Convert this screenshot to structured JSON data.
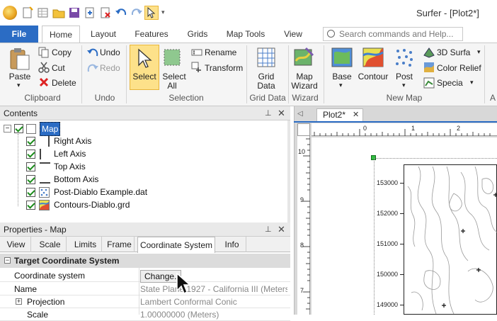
{
  "window": {
    "title": "Surfer - [Plot2*]"
  },
  "ribbon_tabs": [
    "File",
    "Home",
    "Layout",
    "Features",
    "Grids",
    "Map Tools",
    "View"
  ],
  "search": {
    "placeholder": "Search commands and Help..."
  },
  "clipboard": {
    "paste": "Paste",
    "copy": "Copy",
    "cut": "Cut",
    "delete": "Delete",
    "group": "Clipboard"
  },
  "undo": {
    "undo": "Undo",
    "redo": "Redo",
    "group": "Undo"
  },
  "selection": {
    "select": "Select",
    "select_all_1": "Select",
    "select_all_2": "All",
    "rename": "Rename",
    "transform": "Transform",
    "group": "Selection"
  },
  "grid_data": {
    "label_1": "Grid",
    "label_2": "Data",
    "group": "Grid Data"
  },
  "wizard": {
    "label_1": "Map",
    "label_2": "Wizard",
    "group": "Wizard"
  },
  "new_map": {
    "base": "Base",
    "contour": "Contour",
    "post": "Post",
    "surface": "3D Surfa",
    "relief": "Color Relief",
    "specialty": "Specia",
    "group": "New Map",
    "overflow": "A"
  },
  "contents": {
    "title": "Contents",
    "root": "Map",
    "items": [
      "Right Axis",
      "Left Axis",
      "Top Axis",
      "Bottom Axis",
      "Post-Diablo Example.dat",
      "Contours-Diablo.grd"
    ]
  },
  "properties": {
    "title": "Properties - Map",
    "tabs": [
      "View",
      "Scale",
      "Limits",
      "Frame",
      "Coordinate System",
      "Info"
    ],
    "section": "Target Coordinate System",
    "rows": {
      "coord_label": "Coordinate system",
      "coord_button": "Change...",
      "name_label": "Name",
      "name_value": "State Plane 1927 - California III (Meters)",
      "proj_label": "Projection",
      "proj_value": "Lambert Conformal Conic",
      "scale_label": "Scale",
      "scale_value": "1.00000000 (Meters)"
    }
  },
  "document": {
    "tab": "Plot2*",
    "ruler_top": [
      "0",
      "1",
      "2"
    ],
    "ruler_left": [
      "10",
      "9",
      "8",
      "7",
      "6"
    ],
    "y_ticks": [
      "153000",
      "152000",
      "151000",
      "150000",
      "149000"
    ]
  }
}
